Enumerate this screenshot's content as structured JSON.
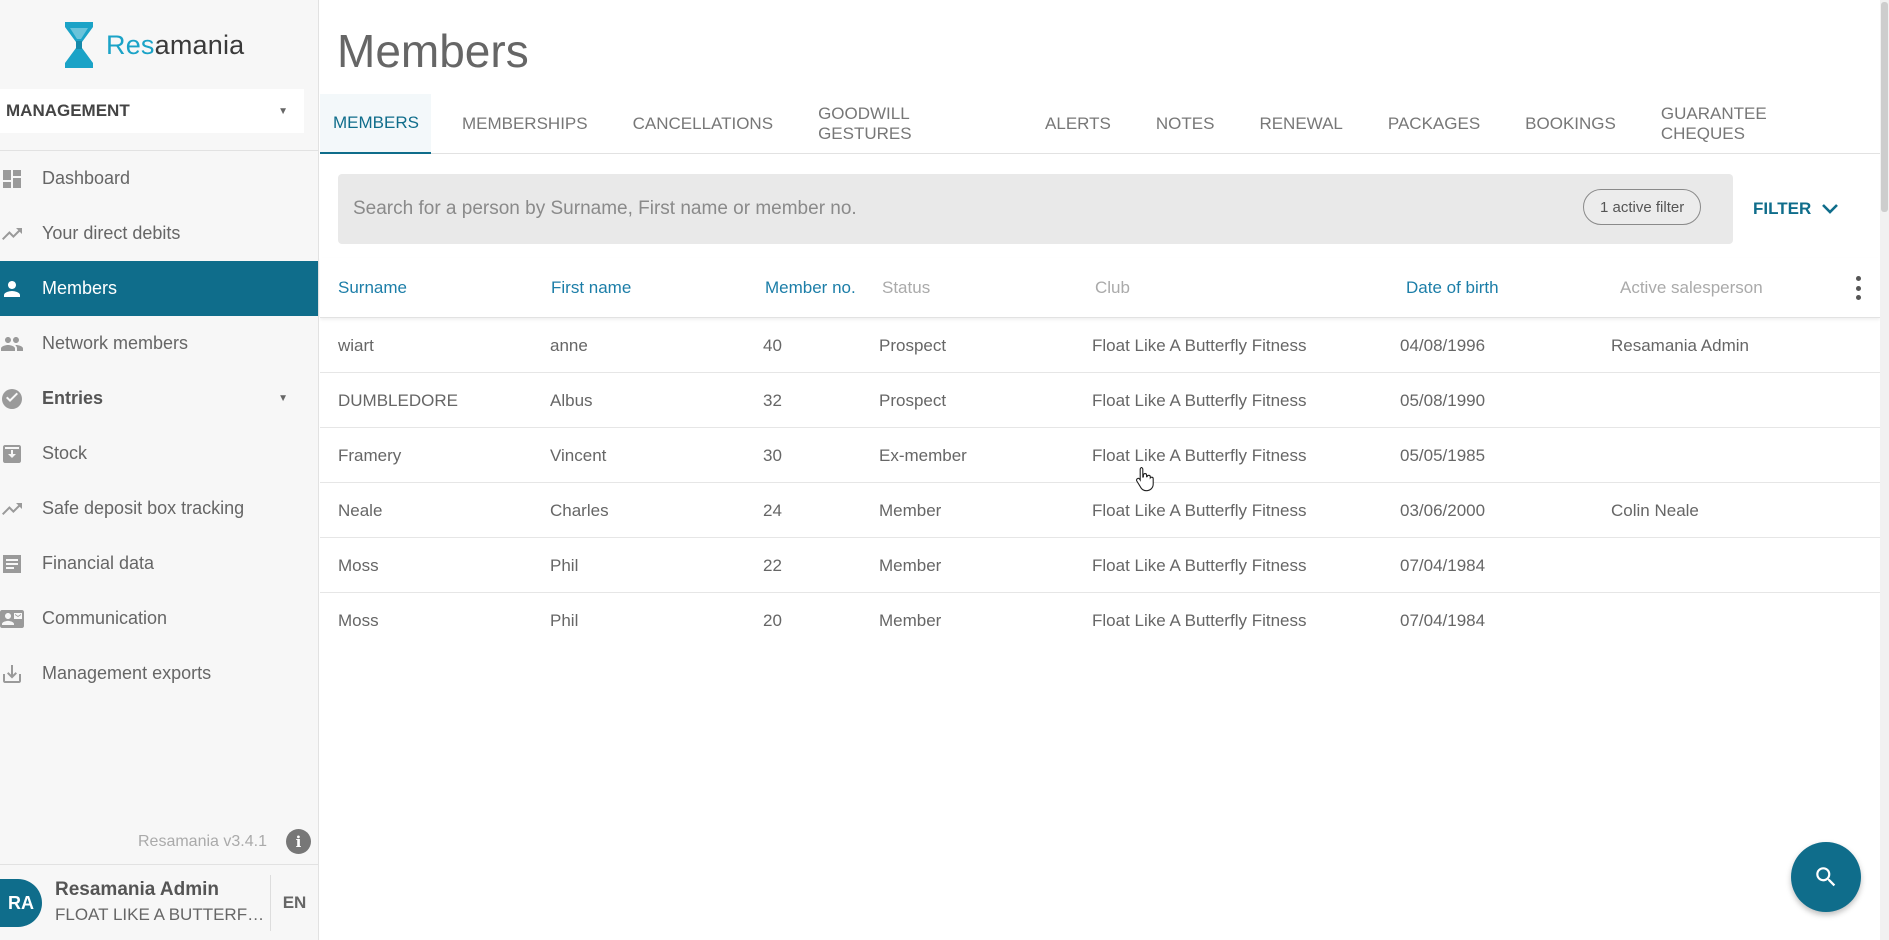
{
  "app": {
    "brand_prefix": "Res",
    "brand_suffix": "amania",
    "brand_color": "#1ba3c7",
    "accent_color": "#0f6d8b"
  },
  "sidebar": {
    "section_select": "MANAGEMENT",
    "items": [
      {
        "label": "Dashboard",
        "icon": "dashboard-icon"
      },
      {
        "label": "Your direct debits",
        "icon": "trending-icon"
      },
      {
        "label": "Members",
        "icon": "person-icon",
        "active": true
      },
      {
        "label": "Network members",
        "icon": "people-icon"
      },
      {
        "label": "Entries",
        "icon": "entries-icon"
      },
      {
        "label": "Stock",
        "icon": "stock-icon"
      },
      {
        "label": "Safe deposit box tracking",
        "icon": "trending-icon"
      },
      {
        "label": "Financial data",
        "icon": "receipt-icon"
      },
      {
        "label": "Communication",
        "icon": "contact-mail-icon"
      },
      {
        "label": "Management exports",
        "icon": "download-icon"
      }
    ],
    "version": "Resamania v3.4.1",
    "user": {
      "initials": "RA",
      "name": "Resamania Admin",
      "club": "FLOAT LIKE A BUTTERFLY FITNESS",
      "lang": "EN"
    }
  },
  "main": {
    "title": "Members",
    "tabs": [
      "MEMBERS",
      "MEMBERSHIPS",
      "CANCELLATIONS",
      "GOODWILL GESTURES",
      "ALERTS",
      "NOTES",
      "RENEWAL",
      "PACKAGES",
      "BOOKINGS",
      "GUARANTEE CHEQUES"
    ],
    "active_tab": "MEMBERS",
    "search": {
      "placeholder": "Search for a person by Surname, First name or member no.",
      "value": "",
      "active_filter": "1 active filter"
    },
    "filter_label": "FILTER",
    "table": {
      "headers": {
        "surname": "Surname",
        "first_name": "First name",
        "member_no": "Member no.",
        "status": "Status",
        "club": "Club",
        "dob": "Date of birth",
        "salesperson": "Active salesperson"
      },
      "rows": [
        {
          "surname": "wiart",
          "first_name": "anne",
          "member_no": "40",
          "status": "Prospect",
          "club": "Float Like A Butterfly Fitness",
          "dob": "04/08/1996",
          "salesperson": "Resamania Admin"
        },
        {
          "surname": "DUMBLEDORE",
          "first_name": "Albus",
          "member_no": "32",
          "status": "Prospect",
          "club": "Float Like A Butterfly Fitness",
          "dob": "05/08/1990",
          "salesperson": ""
        },
        {
          "surname": "Framery",
          "first_name": "Vincent",
          "member_no": "30",
          "status": "Ex-member",
          "club": "Float Like A Butterfly Fitness",
          "dob": "05/05/1985",
          "salesperson": ""
        },
        {
          "surname": "Neale",
          "first_name": "Charles",
          "member_no": "24",
          "status": "Member",
          "club": "Float Like A Butterfly Fitness",
          "dob": "03/06/2000",
          "salesperson": "Colin Neale"
        },
        {
          "surname": "Moss",
          "first_name": "Phil",
          "member_no": "22",
          "status": "Member",
          "club": "Float Like A Butterfly Fitness",
          "dob": "07/04/1984",
          "salesperson": ""
        },
        {
          "surname": "Moss",
          "first_name": "Phil",
          "member_no": "20",
          "status": "Member",
          "club": "Float Like A Butterfly Fitness",
          "dob": "07/04/1984",
          "salesperson": ""
        }
      ]
    }
  }
}
